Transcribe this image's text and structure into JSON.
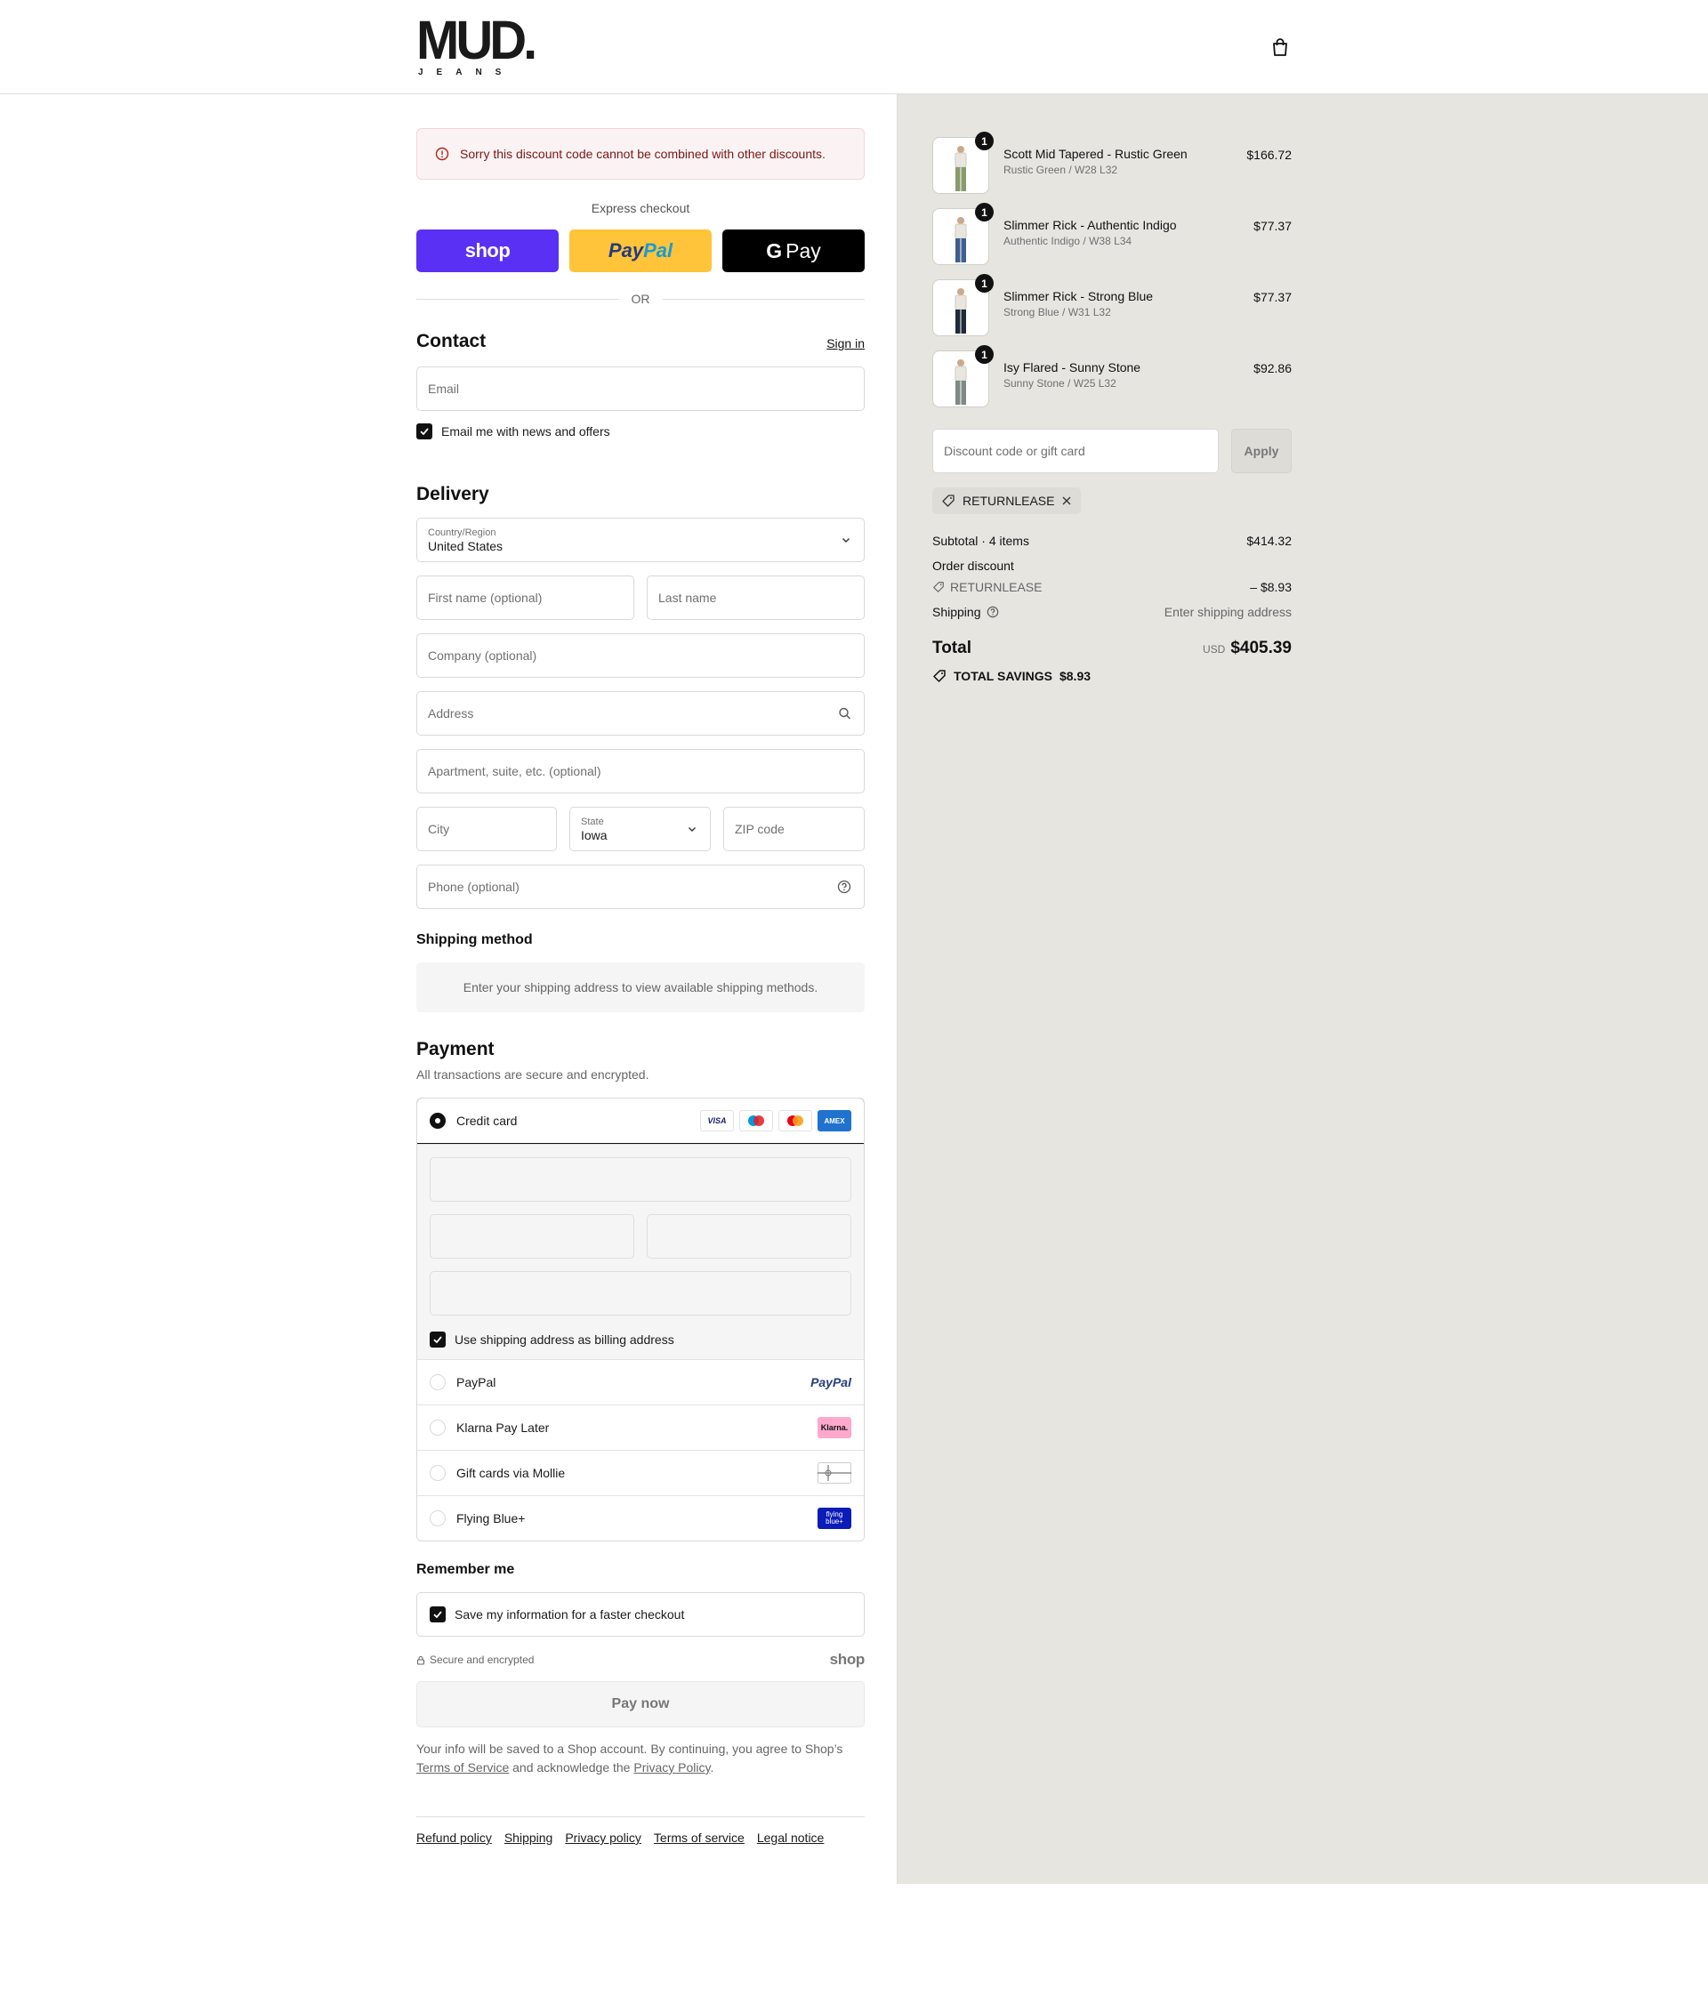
{
  "header": {
    "logo_text": "MUD.",
    "logo_sub": "JEANS"
  },
  "alert": {
    "message": "Sorry this discount code cannot be combined with other discounts."
  },
  "express": {
    "label": "Express checkout",
    "shop_label": "shop",
    "paypal_part1": "Pay",
    "paypal_part2": "Pal",
    "gpay_g": "G",
    "gpay_label": "Pay",
    "or_label": "OR"
  },
  "contact": {
    "title": "Contact",
    "sign_in": "Sign in",
    "email_placeholder": "Email",
    "news_label": "Email me with news and offers",
    "news_checked": true
  },
  "delivery": {
    "title": "Delivery",
    "country_label": "Country/Region",
    "country_value": "United States",
    "first_name_placeholder": "First name (optional)",
    "last_name_placeholder": "Last name",
    "company_placeholder": "Company (optional)",
    "address_placeholder": "Address",
    "apartment_placeholder": "Apartment, suite, etc. (optional)",
    "city_placeholder": "City",
    "state_label": "State",
    "state_value": "Iowa",
    "zip_placeholder": "ZIP code",
    "phone_placeholder": "Phone (optional)"
  },
  "shipping_method": {
    "title": "Shipping method",
    "placeholder": "Enter your shipping address to view available shipping methods."
  },
  "payment": {
    "title": "Payment",
    "subtitle": "All transactions are secure and encrypted.",
    "credit_card_label": "Credit card",
    "card_logos": [
      "VISA",
      "Maestro",
      "Mastercard",
      "AMEX"
    ],
    "billing_same_label": "Use shipping address as billing address",
    "billing_same_checked": true,
    "options": [
      {
        "label": "PayPal",
        "logo": "PayPal"
      },
      {
        "label": "Klarna Pay Later",
        "logo": "Klarna."
      },
      {
        "label": "Gift cards via Mollie",
        "logo": "gift-card-icon"
      },
      {
        "label": "Flying Blue+",
        "logo": "flying blue+"
      }
    ]
  },
  "remember": {
    "title": "Remember me",
    "save_label": "Save my information for a faster checkout",
    "save_checked": true,
    "secure_label": "Secure and encrypted",
    "shop_mark": "shop"
  },
  "pay_now_label": "Pay now",
  "legal": {
    "text_before": "Your info will be saved to a Shop account. By continuing, you agree to Shop’s ",
    "terms_link": "Terms of Service",
    "text_middle": " and acknowledge the ",
    "privacy_link": "Privacy Policy",
    "text_after": "."
  },
  "footer_links": [
    "Refund policy",
    "Shipping",
    "Privacy policy",
    "Terms of service",
    "Legal notice"
  ],
  "summary": {
    "items": [
      {
        "name": "Scott Mid Tapered - Rustic Green",
        "variant": "Rustic Green / W28 L32",
        "price": "$166.72",
        "qty": "1",
        "color": "#8a9a6a"
      },
      {
        "name": "Slimmer Rick - Authentic Indigo",
        "variant": "Authentic Indigo / W38 L34",
        "price": "$77.37",
        "qty": "1",
        "color": "#3e5f8f"
      },
      {
        "name": "Slimmer Rick - Strong Blue",
        "variant": "Strong Blue / W31 L32",
        "price": "$77.37",
        "qty": "1",
        "color": "#1f2a3a"
      },
      {
        "name": "Isy Flared - Sunny Stone",
        "variant": "Sunny Stone / W25 L32",
        "price": "$92.86",
        "qty": "1",
        "color": "#7f8a86"
      }
    ],
    "discount_placeholder": "Discount code or gift card",
    "apply_label": "Apply",
    "applied_code": "RETURNLEASE",
    "subtotal_label": "Subtotal · 4 items",
    "subtotal_value": "$414.32",
    "order_discount_label": "Order discount",
    "order_discount_code": "RETURNLEASE",
    "order_discount_value": "– $8.93",
    "shipping_label": "Shipping",
    "shipping_value": "Enter shipping address",
    "total_label": "Total",
    "total_currency": "USD",
    "total_value": "$405.39",
    "savings_label": "TOTAL SAVINGS",
    "savings_value": "$8.93"
  }
}
